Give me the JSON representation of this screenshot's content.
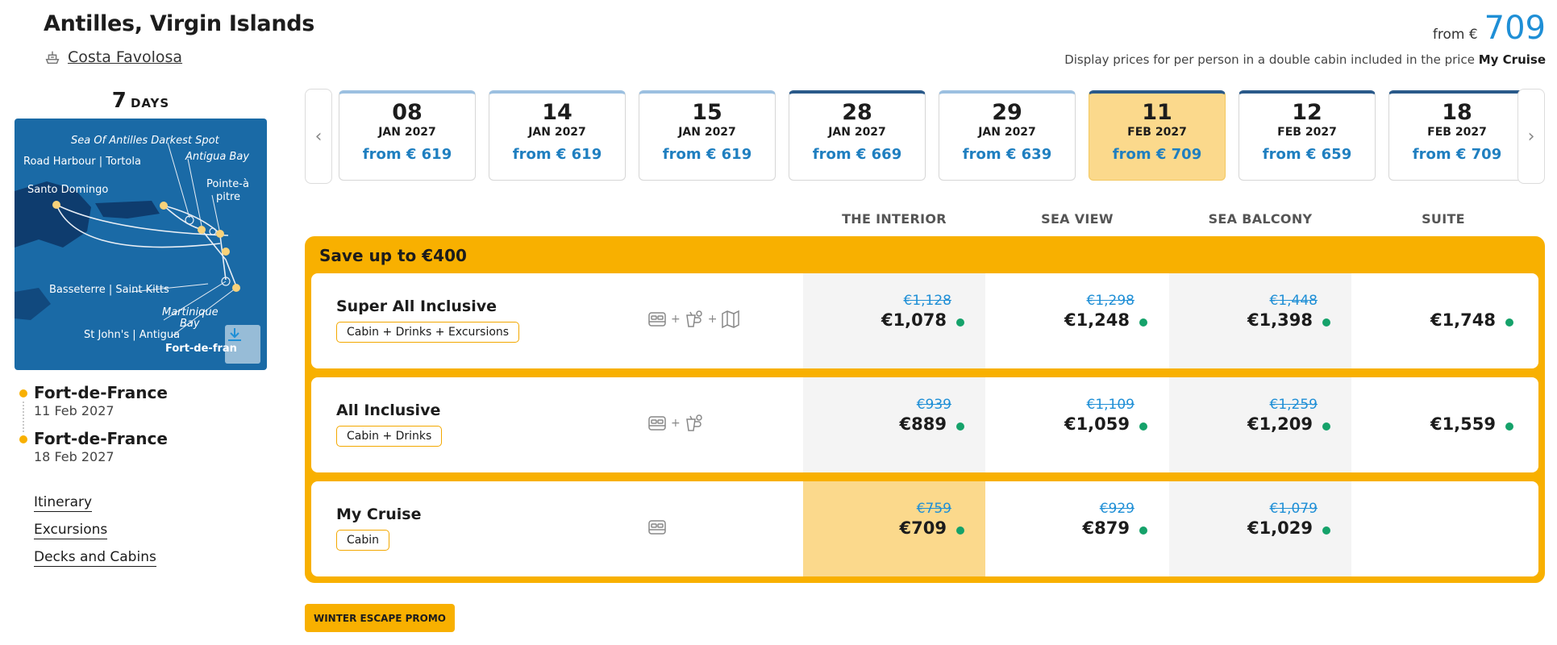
{
  "header": {
    "title": "Antilles, Virgin Islands",
    "ship": "Costa Favolosa",
    "from_label": "from €",
    "from_value": "709",
    "note_text": "Display prices for per person in a double cabin included in the price",
    "note_bold": "My Cruise"
  },
  "duration": {
    "number": "7",
    "label": "DAYS"
  },
  "map": {
    "labels": [
      "Sea Of Antilles Darkest Spot",
      "Road Harbour | Tortola",
      "Antigua Bay",
      "Santo Domingo",
      "Pointe-à",
      "pitre",
      "Basseterre | Saint Kitts",
      "Martinique",
      "Bay",
      "St John's | Antigua",
      "Fort-de-fran"
    ],
    "download_icon": "download-icon",
    "colors": {
      "sea": "#1a6aa6",
      "land": "#0e3c6e",
      "port": "#f8d27a"
    }
  },
  "route": {
    "start": {
      "port": "Fort-de-France",
      "date": "11 Feb 2027"
    },
    "end": {
      "port": "Fort-de-France",
      "date": "18 Feb 2027"
    }
  },
  "side_links": [
    "Itinerary",
    "Excursions",
    "Decks and Cabins"
  ],
  "dates": [
    {
      "day": "08",
      "month": "JAN 2027",
      "price": "from € 619"
    },
    {
      "day": "14",
      "month": "JAN 2027",
      "price": "from € 619"
    },
    {
      "day": "15",
      "month": "JAN 2027",
      "price": "from € 619"
    },
    {
      "day": "28",
      "month": "JAN 2027",
      "price": "from € 669"
    },
    {
      "day": "29",
      "month": "JAN 2027",
      "price": "from € 639"
    },
    {
      "day": "11",
      "month": "FEB 2027",
      "price": "from € 709"
    },
    {
      "day": "12",
      "month": "FEB 2027",
      "price": "from € 659"
    },
    {
      "day": "18",
      "month": "FEB 2027",
      "price": "from € 709"
    }
  ],
  "columns": [
    "THE INTERIOR",
    "SEA VIEW",
    "SEA BALCONY",
    "SUITE"
  ],
  "offer": {
    "title": "Save up to €400",
    "rows": [
      {
        "name": "Super All Inclusive",
        "tag": "Cabin + Drinks + Excursions",
        "prices": [
          {
            "old": "€1,128",
            "new": "€1,078"
          },
          {
            "old": "€1,298",
            "new": "€1,248"
          },
          {
            "old": "€1,448",
            "new": "€1,398"
          },
          {
            "old": "",
            "new": "€1,748"
          }
        ]
      },
      {
        "name": "All Inclusive",
        "tag": "Cabin + Drinks",
        "prices": [
          {
            "old": "€939",
            "new": "€889"
          },
          {
            "old": "€1,109",
            "new": "€1,059"
          },
          {
            "old": "€1,259",
            "new": "€1,209"
          },
          {
            "old": "",
            "new": "€1,559"
          }
        ]
      },
      {
        "name": "My Cruise",
        "tag": "Cabin",
        "prices": [
          {
            "old": "€759",
            "new": "€709"
          },
          {
            "old": "€929",
            "new": "€879"
          },
          {
            "old": "€1,079",
            "new": "€1,029"
          }
        ]
      }
    ]
  },
  "promo": "WINTER ESCAPE PROMO",
  "colors": {
    "accent": "#f8b000",
    "price_blue": "#1f8fd6",
    "available": "#15a26a",
    "selected": "#fbd98c"
  }
}
